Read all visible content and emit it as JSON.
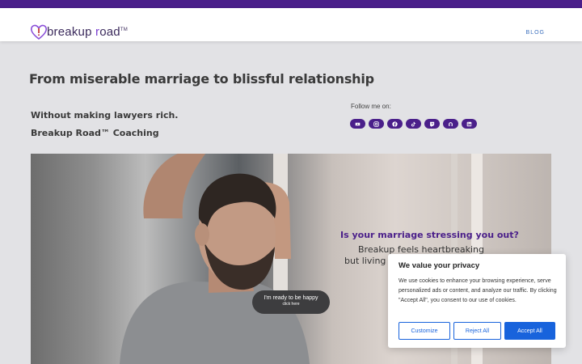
{
  "header": {
    "logo_prefix": "breakup ",
    "logo_accent": "r",
    "logo_suffix": "oad",
    "logo_tm": "TM",
    "nav_blog": "BLOG"
  },
  "hero": {
    "title": "From miserable marriage to blissful relationship",
    "tagline_1": "Without making lawyers rich.",
    "tagline_2": "Breakup Road™ Coaching",
    "follow_label": "Follow me on:",
    "socials": [
      "youtube-icon",
      "instagram-icon",
      "facebook-icon",
      "tiktok-icon",
      "twitch-icon",
      "podcast-icon",
      "linkedin-icon"
    ]
  },
  "banner": {
    "question": "Is your marriage stressing you out?",
    "line_1": "Breakup feels heartbreaking",
    "line_2": "but living li",
    "cta_main": "I'm ready to be happy",
    "cta_sub": "click here"
  },
  "cookie": {
    "title": "We value your privacy",
    "body": "We use cookies to enhance your browsing experience, serve personalized ads or content, and analyze our traffic. By clicking \"Accept All\", you consent to our use of cookies.",
    "customize": "Customize",
    "reject": "Reject All",
    "accept": "Accept All"
  },
  "colors": {
    "brand_purple": "#4a1f8a",
    "cookie_blue": "#1863dc",
    "page_bg": "#e2e2e5"
  }
}
